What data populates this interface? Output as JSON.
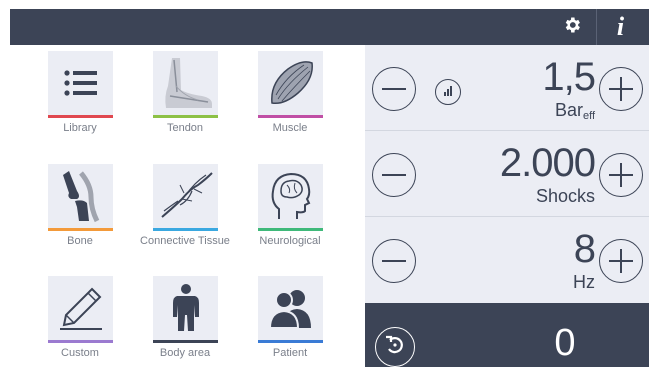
{
  "header": {
    "settings_icon": "gear-icon",
    "info_icon": "info-icon",
    "info_label": "i",
    "background": "#3c4456"
  },
  "grid": {
    "tiles": [
      {
        "label": "Library",
        "icon": "list-icon",
        "accent": "#e0484f"
      },
      {
        "label": "Tendon",
        "icon": "foot-tendon-icon",
        "accent": "#8dc146"
      },
      {
        "label": "Muscle",
        "icon": "muscle-icon",
        "accent": "#c04fa5"
      },
      {
        "label": "Bone",
        "icon": "knee-bone-icon",
        "accent": "#f39a3a"
      },
      {
        "label": "Connective Tissue",
        "icon": "connective-tissue-icon",
        "accent": "#3aa8e0"
      },
      {
        "label": "Neurological",
        "icon": "head-brain-icon",
        "accent": "#3fb97a"
      },
      {
        "label": "Custom",
        "icon": "pencil-icon",
        "accent": "#9b7ad0"
      },
      {
        "label": "Body area",
        "icon": "body-icon",
        "accent": "#3c4456"
      },
      {
        "label": "Patient",
        "icon": "patients-icon",
        "accent": "#3a7bd5"
      }
    ]
  },
  "panel": {
    "pressure": {
      "value": "1,5",
      "unit": "Bar",
      "unit_sub": "eff",
      "gauge_icon": "signal-gauge-icon"
    },
    "shocks": {
      "value": "2.000",
      "unit": "Shocks"
    },
    "frequency": {
      "value": "8",
      "unit": "Hz"
    },
    "counter": {
      "value": "0",
      "reset_icon": "reset-icon"
    }
  }
}
